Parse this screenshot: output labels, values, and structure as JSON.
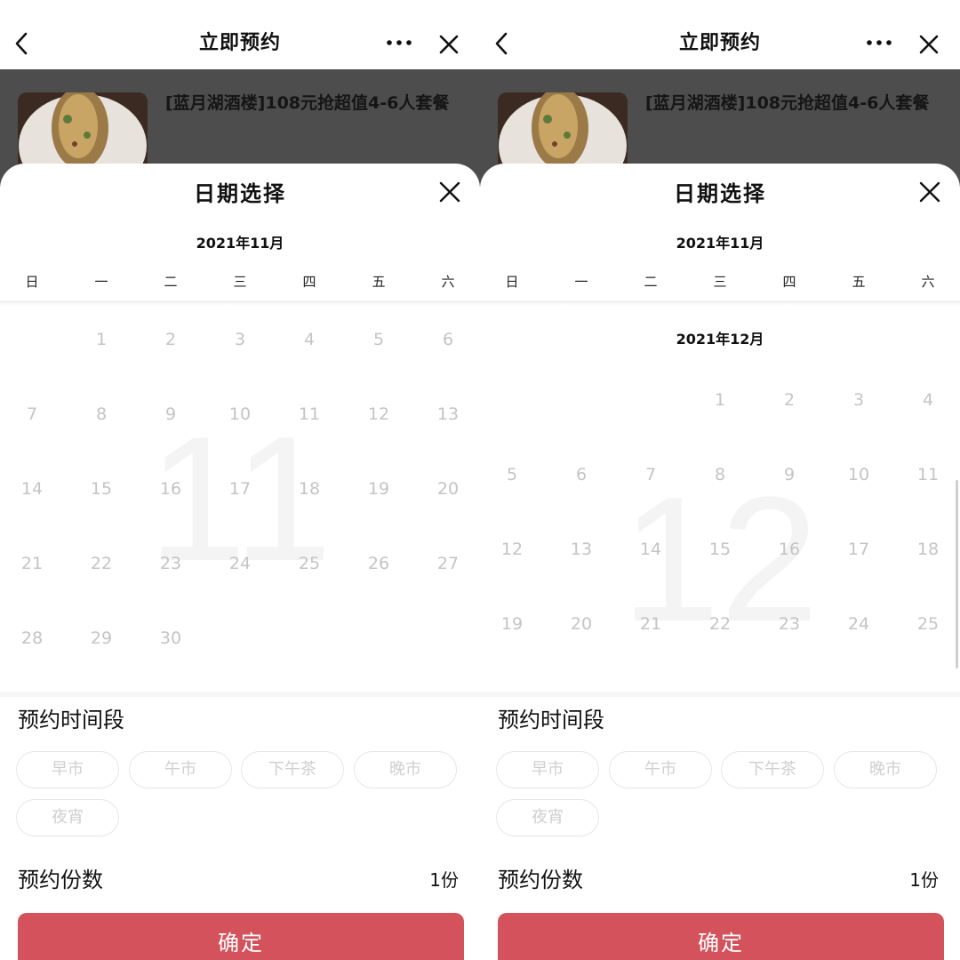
{
  "nav": {
    "title": "立即预约"
  },
  "product": {
    "title": "[蓝月湖酒楼]108元抢超值4-6人套餐"
  },
  "sheet": {
    "title": "日期选择"
  },
  "weekdays": [
    "日",
    "一",
    "二",
    "三",
    "四",
    "五",
    "六"
  ],
  "left": {
    "header_month": "2021年11月",
    "watermark": "11",
    "weeks": [
      [
        "",
        "1",
        "2",
        "3",
        "4",
        "5",
        "6"
      ],
      [
        "7",
        "8",
        "9",
        "10",
        "11",
        "12",
        "13"
      ],
      [
        "14",
        "15",
        "16",
        "17",
        "18",
        "19",
        "20"
      ],
      [
        "21",
        "22",
        "23",
        "24",
        "25",
        "26",
        "27"
      ],
      [
        "28",
        "29",
        "30",
        "",
        "",
        "",
        ""
      ]
    ]
  },
  "right": {
    "header_month": "2021年11月",
    "inline_month": "2021年12月",
    "watermark": "12",
    "weeks": [
      [
        "",
        "",
        "",
        "1",
        "2",
        "3",
        "4"
      ],
      [
        "5",
        "6",
        "7",
        "8",
        "9",
        "10",
        "11"
      ],
      [
        "12",
        "13",
        "14",
        "15",
        "16",
        "17",
        "18"
      ],
      [
        "19",
        "20",
        "21",
        "22",
        "23",
        "24",
        "25"
      ]
    ]
  },
  "time_slot": {
    "label": "预约时间段",
    "options": [
      "早市",
      "午市",
      "下午茶",
      "晚市",
      "夜宵"
    ]
  },
  "quantity": {
    "label": "预约份数",
    "value": "1份"
  },
  "confirm_label": "确定",
  "colors": {
    "accent": "#d3525b",
    "disabled_text": "#c4c4c4",
    "dim_overlay": "#4d4d4d"
  }
}
